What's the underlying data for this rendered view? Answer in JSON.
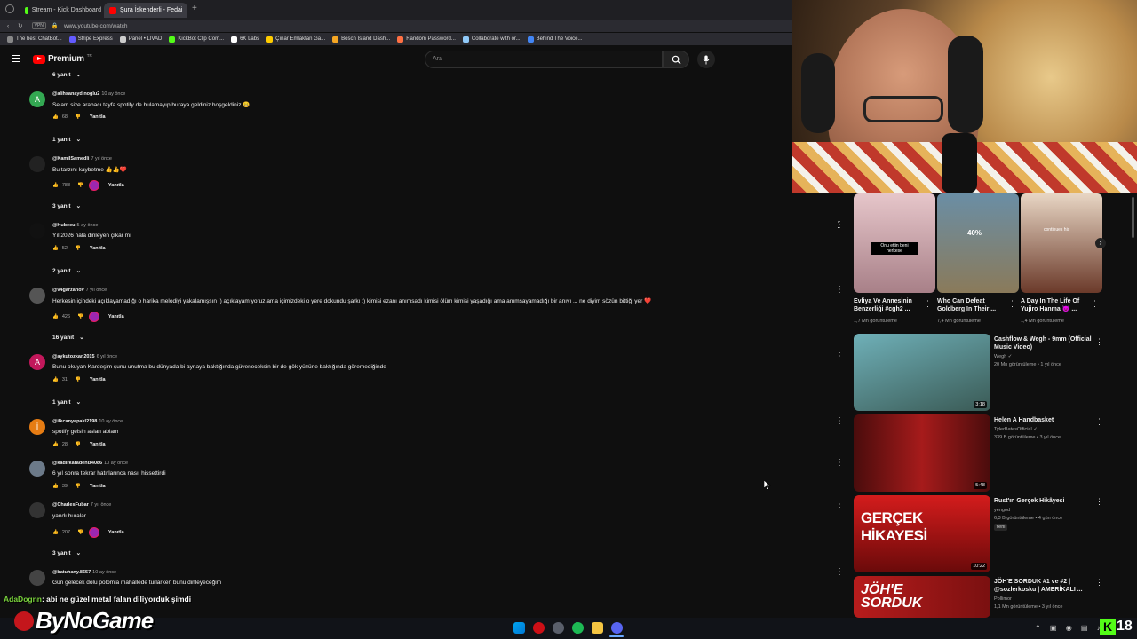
{
  "browser": {
    "tabs": [
      {
        "label": "Stream - Kick Dashboard",
        "color": "#53fc18"
      },
      {
        "label": "Şura İskenderli - Fedai",
        "color": "#ff0000"
      }
    ],
    "url": "www.youtube.com/watch",
    "bookmarks": [
      {
        "label": "The best ChatBot..."
      },
      {
        "label": "Stripe Express"
      },
      {
        "label": "Panel • LIVAD"
      },
      {
        "label": "KickBot Clip Com..."
      },
      {
        "label": "6K Labs"
      },
      {
        "label": "Çınar Emlaktan Ga..."
      },
      {
        "label": "Bosch Island Dash..."
      },
      {
        "label": "Random Password..."
      },
      {
        "label": "Collaborate with or..."
      },
      {
        "label": "Behind The Voice..."
      }
    ]
  },
  "youtube": {
    "logo_text": "Premium",
    "logo_badge": "TR",
    "search_placeholder": "Ara"
  },
  "comments": [
    {
      "replies_above": "6 yanıt",
      "user": "@alihsanaydinoglu2",
      "time": "10 ay önce",
      "text": "Selam size arabacı tayfa spotify de bulamayıp buraya geldiniz hoşgeldiniz 😄",
      "likes": "68",
      "reply": "Yanıtla",
      "avatar_letter": "A",
      "avatar_color": "#33a852",
      "replies": "1 yanıt"
    },
    {
      "user": "@KamilSamedli",
      "time": "7 yıl önce",
      "text": "Bu tarzını kaybetme 👍👍❤️",
      "likes": "788",
      "reply": "Yanıtla",
      "avatar_letter": "",
      "avatar_color": "#222222",
      "replies": "3 yanıt"
    },
    {
      "user": "@Hubeeu",
      "time": "5 ay önce",
      "text": "Yıl 2026 hala dinleyen çıkar mı",
      "likes": "52",
      "reply": "Yanıtla",
      "avatar_letter": "",
      "avatar_color": "#111111",
      "replies": "2 yanıt"
    },
    {
      "user": "@v4garzanov",
      "time": "7 yıl önce",
      "text": "Herkesin içindeki açıklayamadığı o harika melodiyi yakalamışsın :) açıklayamıyoruz ama içimizdeki o yere dokundu şarkı :) kimisi ezanı anımsadı kimisi ölüm kimisi yaşadığı ama anımsayamadığı bir anıyı ... ne diyim sözün bittiği yer ❤️",
      "likes": "426",
      "reply": "Yanıtla",
      "avatar_letter": "",
      "avatar_color": "#555555",
      "replies": "16 yanıt"
    },
    {
      "user": "@aykutozkan2015",
      "time": "6 yıl önce",
      "text": "Bunu okuyan Kardeşim şunu unutma bu dünyada bi aynaya baktığında güveneceksin bir de gök yüzüne baktığında göremediğinde",
      "likes": "31",
      "reply": "Yanıtla",
      "avatar_letter": "A",
      "avatar_color": "#c2185b",
      "replies": "1 yanıt"
    },
    {
      "user": "@ilkcanyapakl2198",
      "time": "10 ay önce",
      "text": "spotify gelsin aslan ablam",
      "likes": "28",
      "reply": "Yanıtla",
      "avatar_letter": "İ",
      "avatar_color": "#e67c13",
      "replies": ""
    },
    {
      "user": "@kadirkaradeniz4086",
      "time": "10 ay önce",
      "text": "6 yıl sonra tekrar hatırlarınca nasıl hissettirdi",
      "likes": "39",
      "reply": "Yanıtla",
      "avatar_letter": "",
      "avatar_color": "#6c7a89",
      "replies": ""
    },
    {
      "user": "@CharlesFubar",
      "time": "7 yıl önce",
      "text": "yandı buralar.",
      "likes": "207",
      "reply": "Yanıtla",
      "avatar_letter": "",
      "avatar_color": "#333333",
      "replies": "3 yanıt"
    },
    {
      "user": "@batuhany.8657",
      "time": "10 ay önce",
      "text": "Gün gelecek dolu polomla mahallede turlarken bunu dinleyeceğim",
      "likes": "",
      "reply": "",
      "avatar_letter": "",
      "avatar_color": "#444444",
      "replies": ""
    }
  ],
  "shorts": [
    {
      "title": "Evliya Ve Annesinin Benzerliği #cgh2 ...",
      "views": "1,7 Mn görüntüleme",
      "overlay": "Onu ettin beni herkese",
      "color": "#c9a0a8"
    },
    {
      "title": "Who Can Defeat Goldberg In Their ...",
      "views": "7,4 Mn görüntüleme",
      "overlay": "40%",
      "color": "#8a7a5a"
    },
    {
      "title": "A Day In The Life Of Yujiro Hanma 👿 ...",
      "views": "1,4 Mn görüntüleme",
      "overlay": "continues his",
      "color": "#6b3a2a"
    }
  ],
  "suggestions": [
    {
      "title": "Cashflow & Wegh - 9mm (Official Music Video)",
      "channel": "Wegh ✓",
      "meta": "20 Mn görüntüleme • 1 yıl önce",
      "badge": "",
      "duration": "3:18",
      "color": "#4d8f9a"
    },
    {
      "title": "Helen A Handbasket",
      "channel": "TylerBatesOfficial ✓",
      "meta": "339 B görüntüleme • 3 yıl önce",
      "badge": "",
      "duration": "5:48",
      "color": "#8b1a1a"
    },
    {
      "title": "Rust'ın Gerçek Hikâyesi",
      "channel": "yengod",
      "meta": "6,3 B görüntüleme • 4 gün önce",
      "badge": "Yeni",
      "duration": "10:22",
      "color": "#b01010"
    },
    {
      "title": "JÖH'E SORDUK #1 ve #2 | @sozlerkosku | AMERİKALI ...",
      "channel": "Pollimor",
      "meta": "1,1 Mn görüntüleme • 3 yıl önce",
      "badge": "",
      "duration": "",
      "color": "#c62828"
    }
  ],
  "stream": {
    "chat_user": "AdaDognn",
    "chat_text": ": abi ne güzel metal falan diliyorduk şimdi",
    "brand": "ByNoGame",
    "overlay_badge": "18"
  }
}
